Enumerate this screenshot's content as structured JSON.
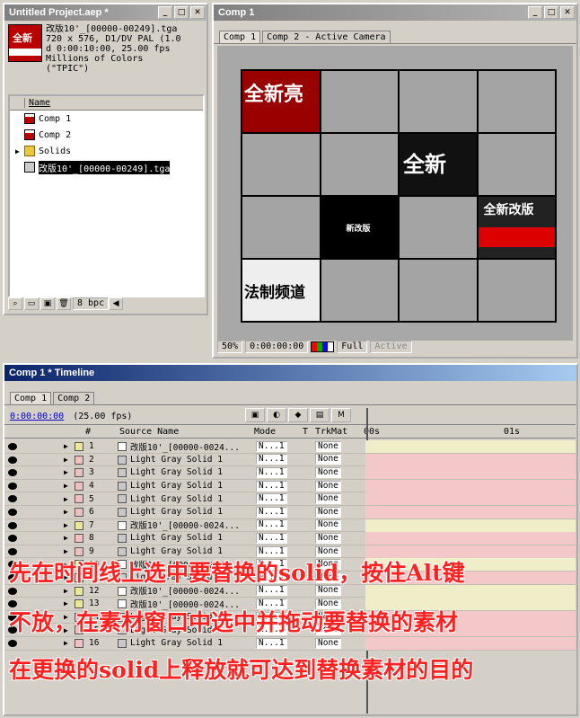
{
  "project": {
    "title": "Untitled Project.aep *",
    "info_lines": "改版10'_[00000-00249].tga\n720 x 576, D1/DV PAL (1.0\nd 0:00:10:00, 25.00 fps\nMillions of Colors\n(\"TPIC\")",
    "column_name": "Name",
    "items": [
      "Comp 1",
      "Comp 2",
      "Solids",
      "改版10'_[00000-00249].tga"
    ],
    "bpc": "8 bpc"
  },
  "comp": {
    "title": "Comp 1",
    "tabs": [
      "Comp 1",
      "Comp 2 - Active Camera"
    ],
    "cells": [
      "全新亮",
      "",
      "",
      "",
      "",
      "",
      "全新",
      "",
      "",
      "新改版",
      "",
      "全新改版",
      "法制频道",
      "",
      "",
      ""
    ],
    "zoom": "50%",
    "timecode": "0:00:00:00",
    "resolution": "Full",
    "camera": "Active"
  },
  "timeline": {
    "title": "Comp 1 * Timeline",
    "tabs": [
      "Comp 1",
      "Comp 2"
    ],
    "timecode": "0:00:00:00",
    "fps": "(25.00 fps)",
    "ruler": [
      "00s",
      "01s"
    ],
    "headers": {
      "num": "#",
      "source": "Source Name",
      "mode": "Mode",
      "t": "T",
      "trkmat": "TrkMat"
    },
    "mode_value": "N...1",
    "trkmat_value": "None",
    "layers": [
      {
        "n": "1",
        "name": "改版10'_[00000-0024...",
        "type": "foot"
      },
      {
        "n": "2",
        "name": "Light Gray Solid 1",
        "type": "solid"
      },
      {
        "n": "3",
        "name": "Light Gray Solid 1",
        "type": "solid"
      },
      {
        "n": "4",
        "name": "Light Gray Solid 1",
        "type": "solid"
      },
      {
        "n": "5",
        "name": "Light Gray Solid 1",
        "type": "solid"
      },
      {
        "n": "6",
        "name": "Light Gray Solid 1",
        "type": "solid"
      },
      {
        "n": "7",
        "name": "改版10'_[00000-0024...",
        "type": "foot"
      },
      {
        "n": "8",
        "name": "Light Gray Solid 1",
        "type": "solid"
      },
      {
        "n": "9",
        "name": "Light Gray Solid 1",
        "type": "solid"
      },
      {
        "n": "10",
        "name": "改版10'_[00000-0024...",
        "type": "foot"
      },
      {
        "n": "11",
        "name": "Light Gray Solid 1",
        "type": "solid"
      },
      {
        "n": "12",
        "name": "改版10'_[00000-0024...",
        "type": "foot"
      },
      {
        "n": "13",
        "name": "改版10'_[00000-0024...",
        "type": "foot"
      },
      {
        "n": "14",
        "name": "Light Gray Solid 1",
        "type": "solid"
      },
      {
        "n": "15",
        "name": "Light Gray Solid 1",
        "type": "solid"
      },
      {
        "n": "16",
        "name": "Light Gray Solid 1",
        "type": "solid"
      }
    ]
  },
  "overlay": [
    "先在时间线上选中要替换的solid，按住Alt键",
    "不放，在素材窗口中选中并拖动要替换的素材",
    "在更换的solid上释放就可达到替换素材的目的"
  ],
  "colors": {
    "accent": "#0a246a",
    "overlay_text": "#ff2020",
    "solid_bar": "#f4c8c8",
    "footage_bar": "#f0eec8"
  }
}
